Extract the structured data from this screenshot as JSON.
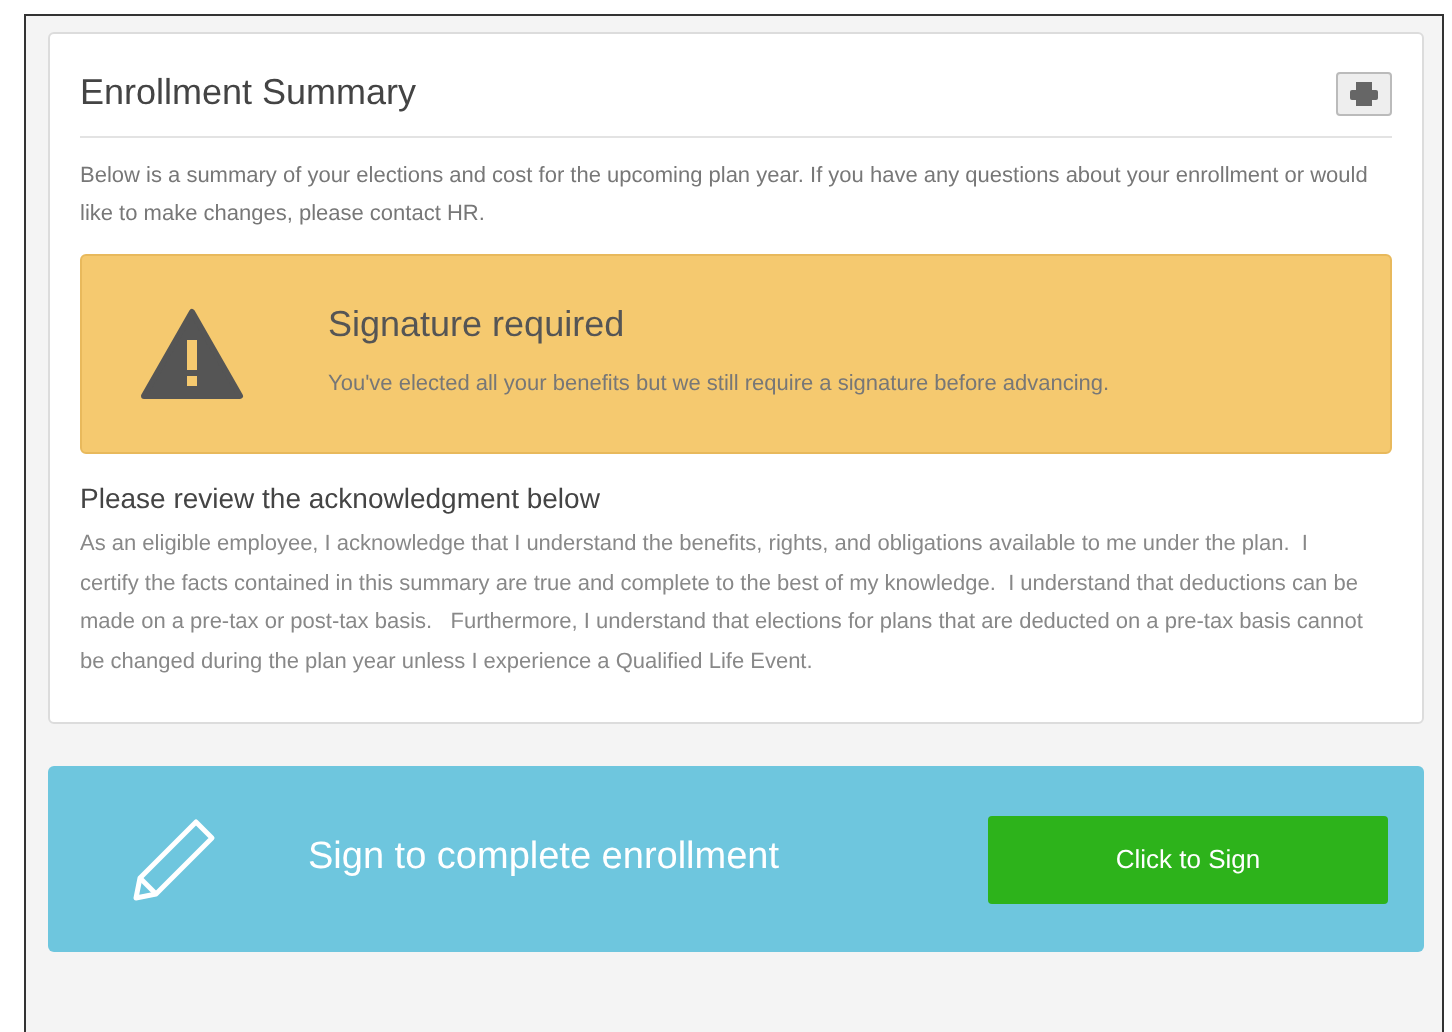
{
  "summary": {
    "title": "Enrollment Summary",
    "intro": "Below is a summary of your elections and cost for the upcoming plan year. If you have any questions about your enrollment or would like to make changes, please contact HR.",
    "alert": {
      "title": "Signature required",
      "message": "You've elected all your benefits but we still require a signature before advancing."
    },
    "acknowledgment": {
      "heading": "Please review the acknowledgment below",
      "text": "As an eligible employee, I acknowledge that I understand the benefits, rights, and obligations available to me under the plan.  I certify the facts contained in this summary are true and complete to the best of my knowledge.  I understand that deductions can be made on a pre-tax or post-tax basis.   Furthermore, I understand that elections for plans that are deducted on a pre-tax basis cannot be changed during the plan year unless I experience a Qualified Life Event."
    }
  },
  "sign_bar": {
    "label": "Sign to complete enrollment",
    "button": "Click to Sign"
  }
}
